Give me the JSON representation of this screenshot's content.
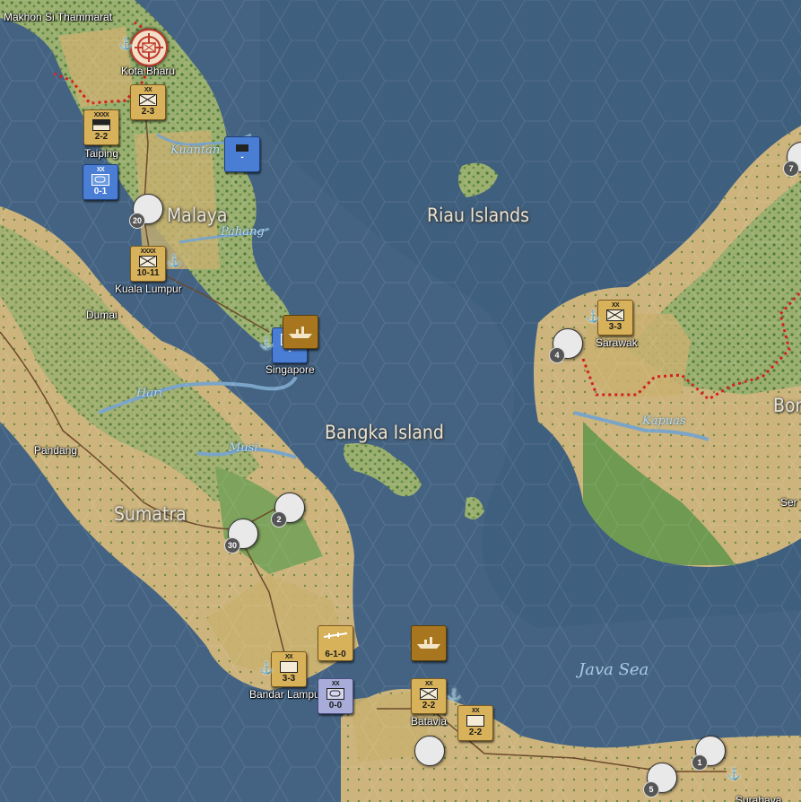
{
  "map": {
    "sea_name": "Java Sea",
    "regions": [
      "Malaya",
      "Riau Islands",
      "Bangka Island",
      "Sumatra",
      "Bor"
    ],
    "cities": [
      "Makhon Si Thammarat",
      "Kota Bharu",
      "Taiping",
      "Kuala Lumpur",
      "Dumai",
      "Singapore",
      "Pandang",
      "Sarawak",
      "Batavia",
      "Bandar Lampu",
      "Surabaya",
      "Ser"
    ],
    "rivers": [
      "Kuantan",
      "Pahang",
      "Hari",
      "Musi",
      "Kapuas"
    ],
    "colors": {
      "sea": "#3f5f7e",
      "jungle": "#8ea66a",
      "plain": "#c8b078",
      "allied": "#d8b25a",
      "axis_blue": "#4a7ed4",
      "border": "#d22020"
    }
  },
  "units": [
    {
      "size": "XX",
      "value": "2-3"
    },
    {
      "size": "XXXX",
      "value": "2-2"
    },
    {
      "size": "XX",
      "value": "0-1"
    },
    {
      "size": "XXXX",
      "value": "10-11"
    },
    {
      "size": "",
      "value": "-"
    },
    {
      "size": "",
      "value": "-"
    },
    {
      "size": "XX",
      "value": "3-3"
    },
    {
      "size": "",
      "value": "6-1-0"
    },
    {
      "size": "XX",
      "value": "3-3"
    },
    {
      "size": "XX",
      "value": "0-0"
    },
    {
      "size": "XX",
      "value": "2-2"
    },
    {
      "size": "XX",
      "value": "2-2"
    }
  ],
  "stacks": [
    "20",
    "4",
    "2",
    "30",
    "7",
    "1",
    "5"
  ],
  "markers": {
    "target_icon": "crosshair-target-icon",
    "port_icon": "anchor-icon",
    "airfield_icon": "airfield-icon"
  }
}
